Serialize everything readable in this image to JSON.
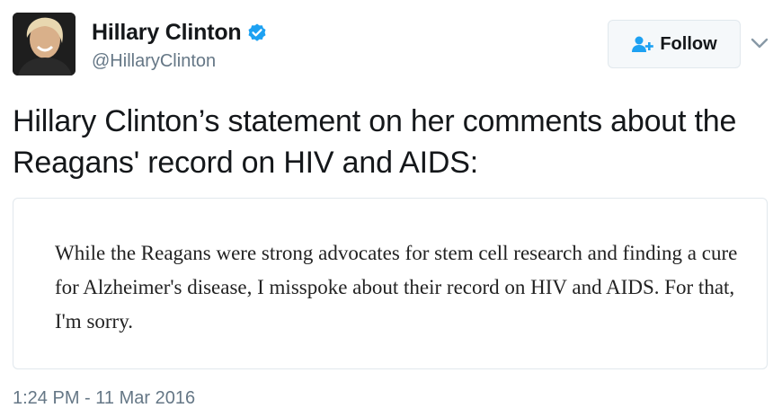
{
  "author": {
    "display_name": "Hillary Clinton",
    "handle": "@HillaryClinton",
    "verified": true,
    "avatar_icon": "profile-photo"
  },
  "actions": {
    "follow_label": "Follow",
    "follow_icon": "add-user-icon",
    "menu_icon": "chevron-down-icon"
  },
  "tweet": {
    "text": "Hillary Clinton’s statement on her comments about the Reagans' record on HIV and AIDS:",
    "statement_image_text": "While the Reagans were strong advocates for stem cell research and finding a cure for Alzheimer's disease, I misspoke about their record on HIV and AIDS. For that, I'm sorry.",
    "timestamp": "1:24 PM - 11 Mar 2016"
  },
  "colors": {
    "accent": "#1da1f2",
    "text_primary": "#14171a",
    "text_secondary": "#657786",
    "border": "#e1e8ed"
  }
}
